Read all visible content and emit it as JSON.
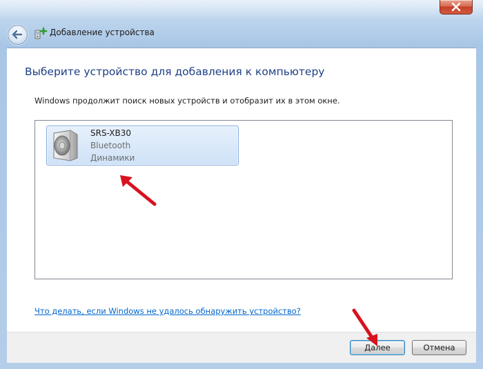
{
  "window": {
    "title": "Добавление устройства"
  },
  "content": {
    "heading": "Выберите устройство для добавления к компьютеру",
    "subtext": "Windows продолжит поиск новых устройств и отобразит их в этом окне."
  },
  "devices": [
    {
      "name": "SRS-XB30",
      "type": "Bluetooth",
      "category": "Динамики",
      "icon": "speaker-icon",
      "selected": true
    }
  ],
  "help_link": "Что делать, если Windows не удалось обнаружить устройство?",
  "buttons": {
    "next": "Далее",
    "cancel": "Отмена"
  },
  "colors": {
    "heading": "#1e3f84",
    "link": "#0066cc",
    "annotation_arrow": "#d8121f",
    "selection": "#cfe2f8"
  }
}
